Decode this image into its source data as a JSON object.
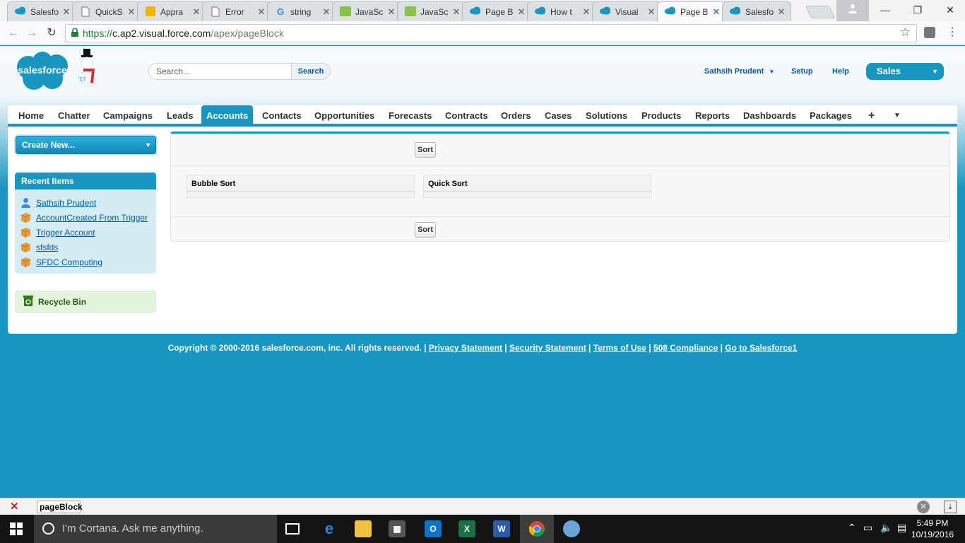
{
  "browser": {
    "tabs": [
      {
        "label": "Salesfo",
        "icon": "cloud"
      },
      {
        "label": "QuickS",
        "icon": "page"
      },
      {
        "label": "Appra",
        "icon": "yellow"
      },
      {
        "label": "Error",
        "icon": "page"
      },
      {
        "label": "string",
        "icon": "google"
      },
      {
        "label": "JavaSc",
        "icon": "green"
      },
      {
        "label": "JavaSc",
        "icon": "green"
      },
      {
        "label": "Page B",
        "icon": "cloud"
      },
      {
        "label": "How t",
        "icon": "cloud"
      },
      {
        "label": "Visual",
        "icon": "cloud"
      },
      {
        "label": "Page B",
        "icon": "cloud"
      },
      {
        "label": "Salesfo",
        "icon": "cloud"
      }
    ],
    "active_tab": 10,
    "url_scheme": "https://",
    "url_host": "c.ap2.visual.force.com",
    "url_path": "/apex/pageBlock"
  },
  "header": {
    "logo_text": "salesforce",
    "snowman_year": "'17",
    "search_placeholder": "Search...",
    "search_button": "Search",
    "user_name": "Sathsih Prudent",
    "setup": "Setup",
    "help": "Help",
    "app_name": "Sales"
  },
  "nav": {
    "tabs": [
      "Home",
      "Chatter",
      "Campaigns",
      "Leads",
      "Accounts",
      "Contacts",
      "Opportunities",
      "Forecasts",
      "Contracts",
      "Orders",
      "Cases",
      "Solutions",
      "Products",
      "Reports",
      "Dashboards",
      "Packages"
    ],
    "active": "Accounts",
    "plus": "+",
    "more": "▼"
  },
  "sidebar": {
    "create_new": "Create New...",
    "recent_title": "Recent Items",
    "recent_items": [
      {
        "label": "Sathsih Prudent",
        "type": "user"
      },
      {
        "label": "AccountCreated From Trigger",
        "type": "account"
      },
      {
        "label": "Trigger Account",
        "type": "account"
      },
      {
        "label": "sfsfds",
        "type": "account"
      },
      {
        "label": "SFDC Computing",
        "type": "account"
      }
    ],
    "recycle_bin": "Recycle Bin"
  },
  "pageblock": {
    "top_button": "Sort",
    "bottom_button": "Sort",
    "sections": [
      "Bubble Sort",
      "Quick Sort"
    ]
  },
  "footer": {
    "copyright": "Copyright © 2000-2016 salesforce.com, inc. All rights reserved. |",
    "links": [
      "Privacy Statement",
      "Security Statement",
      "Terms of Use",
      "508 Compliance",
      "Go to Salesforce1"
    ]
  },
  "findbar": {
    "query": "pageBlock"
  },
  "taskbar": {
    "cortana_placeholder": "I'm Cortana. Ask me anything.",
    "time": "5:49 PM",
    "date": "10/19/2016"
  },
  "colors": {
    "sf_blue": "#1797c0",
    "link_blue": "#015ba7"
  }
}
